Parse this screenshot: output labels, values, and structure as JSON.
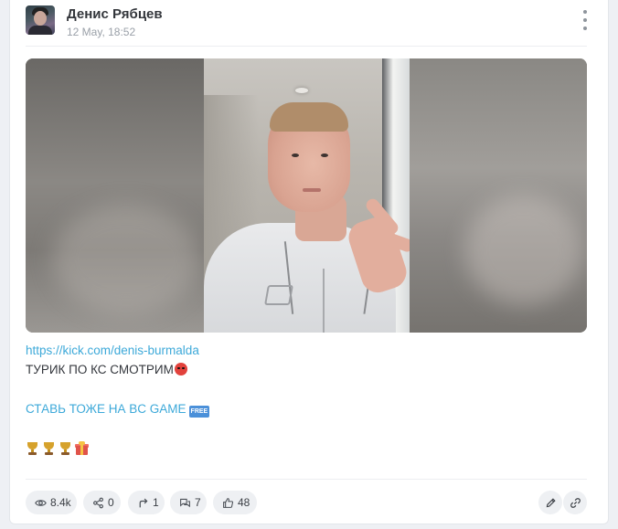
{
  "post": {
    "author": "Денис Рябцев",
    "date": "12 May, 18:52",
    "more_icon": "more-vertical-icon",
    "link": "https://kick.com/denis-burmalda",
    "line1": "ТУРИК ПО КС СМОТРИМ",
    "line1_emoji": "angry-face-emoji",
    "line2": "СТАВЬ ТОЖЕ НА BC GAME",
    "line2_emoji": "FREE",
    "line3_emojis": [
      "trophy-emoji",
      "trophy-emoji",
      "trophy-emoji",
      "gift-emoji"
    ]
  },
  "stats": {
    "views": "8.4k",
    "shares": "0",
    "reposts": "1",
    "comments": "7",
    "likes": "48"
  },
  "actions": {
    "edit_icon": "pencil-icon",
    "copy_link_icon": "link-icon"
  },
  "colors": {
    "link": "#3da9d9",
    "pill_bg": "#eef0f3",
    "card_bg": "#ffffff",
    "page_bg": "#eef0f4"
  }
}
